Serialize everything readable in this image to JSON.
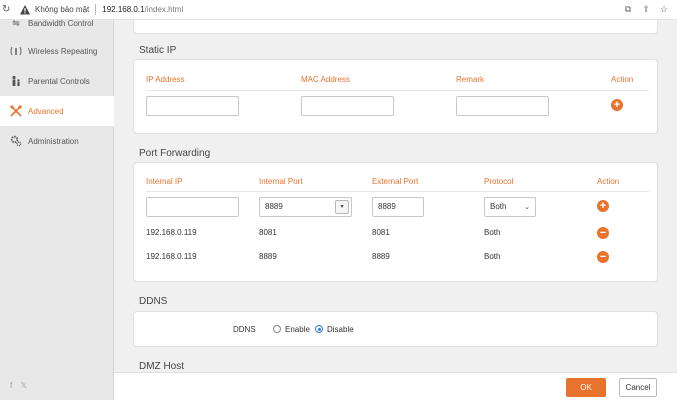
{
  "browser": {
    "security_label": "Không bảo mật",
    "url_host": "192.168.0.1",
    "url_path": "/index.html"
  },
  "sidebar": {
    "items": [
      {
        "label": "Bandwidth Control",
        "icon": "bandwidth-icon"
      },
      {
        "label": "Wireless Repeating",
        "icon": "wireless-icon"
      },
      {
        "label": "Parental Controls",
        "icon": "parental-icon"
      },
      {
        "label": "Advanced",
        "icon": "tools-icon",
        "active": true
      },
      {
        "label": "Administration",
        "icon": "gear-icon"
      }
    ],
    "social": "f  𝕏"
  },
  "static_ip": {
    "title": "Static IP",
    "headers": [
      "IP Address",
      "MAC Address",
      "Remark",
      "Action"
    ]
  },
  "port_forwarding": {
    "title": "Port Forwarding",
    "headers": [
      "Internal IP",
      "Internal Port",
      "External Port",
      "Protocol",
      "Action"
    ],
    "new_row": {
      "internal_port": "8889",
      "external_port": "8889",
      "protocol": "Both"
    },
    "rows": [
      {
        "internal_ip": "192.168.0.119",
        "internal_port": "8081",
        "external_port": "8081",
        "protocol": "Both"
      },
      {
        "internal_ip": "192.168.0.119",
        "internal_port": "8889",
        "external_port": "8889",
        "protocol": "Both"
      }
    ]
  },
  "ddns": {
    "title": "DDNS",
    "label": "DDNS",
    "options": [
      "Enable",
      "Disable"
    ],
    "selected": "Disable"
  },
  "dmz": {
    "title": "DMZ Host"
  },
  "footer": {
    "ok_label": "OK",
    "cancel_label": "Cancel"
  },
  "colors": {
    "accent": "#e8732e",
    "radio_selected": "#2a7ed8"
  }
}
